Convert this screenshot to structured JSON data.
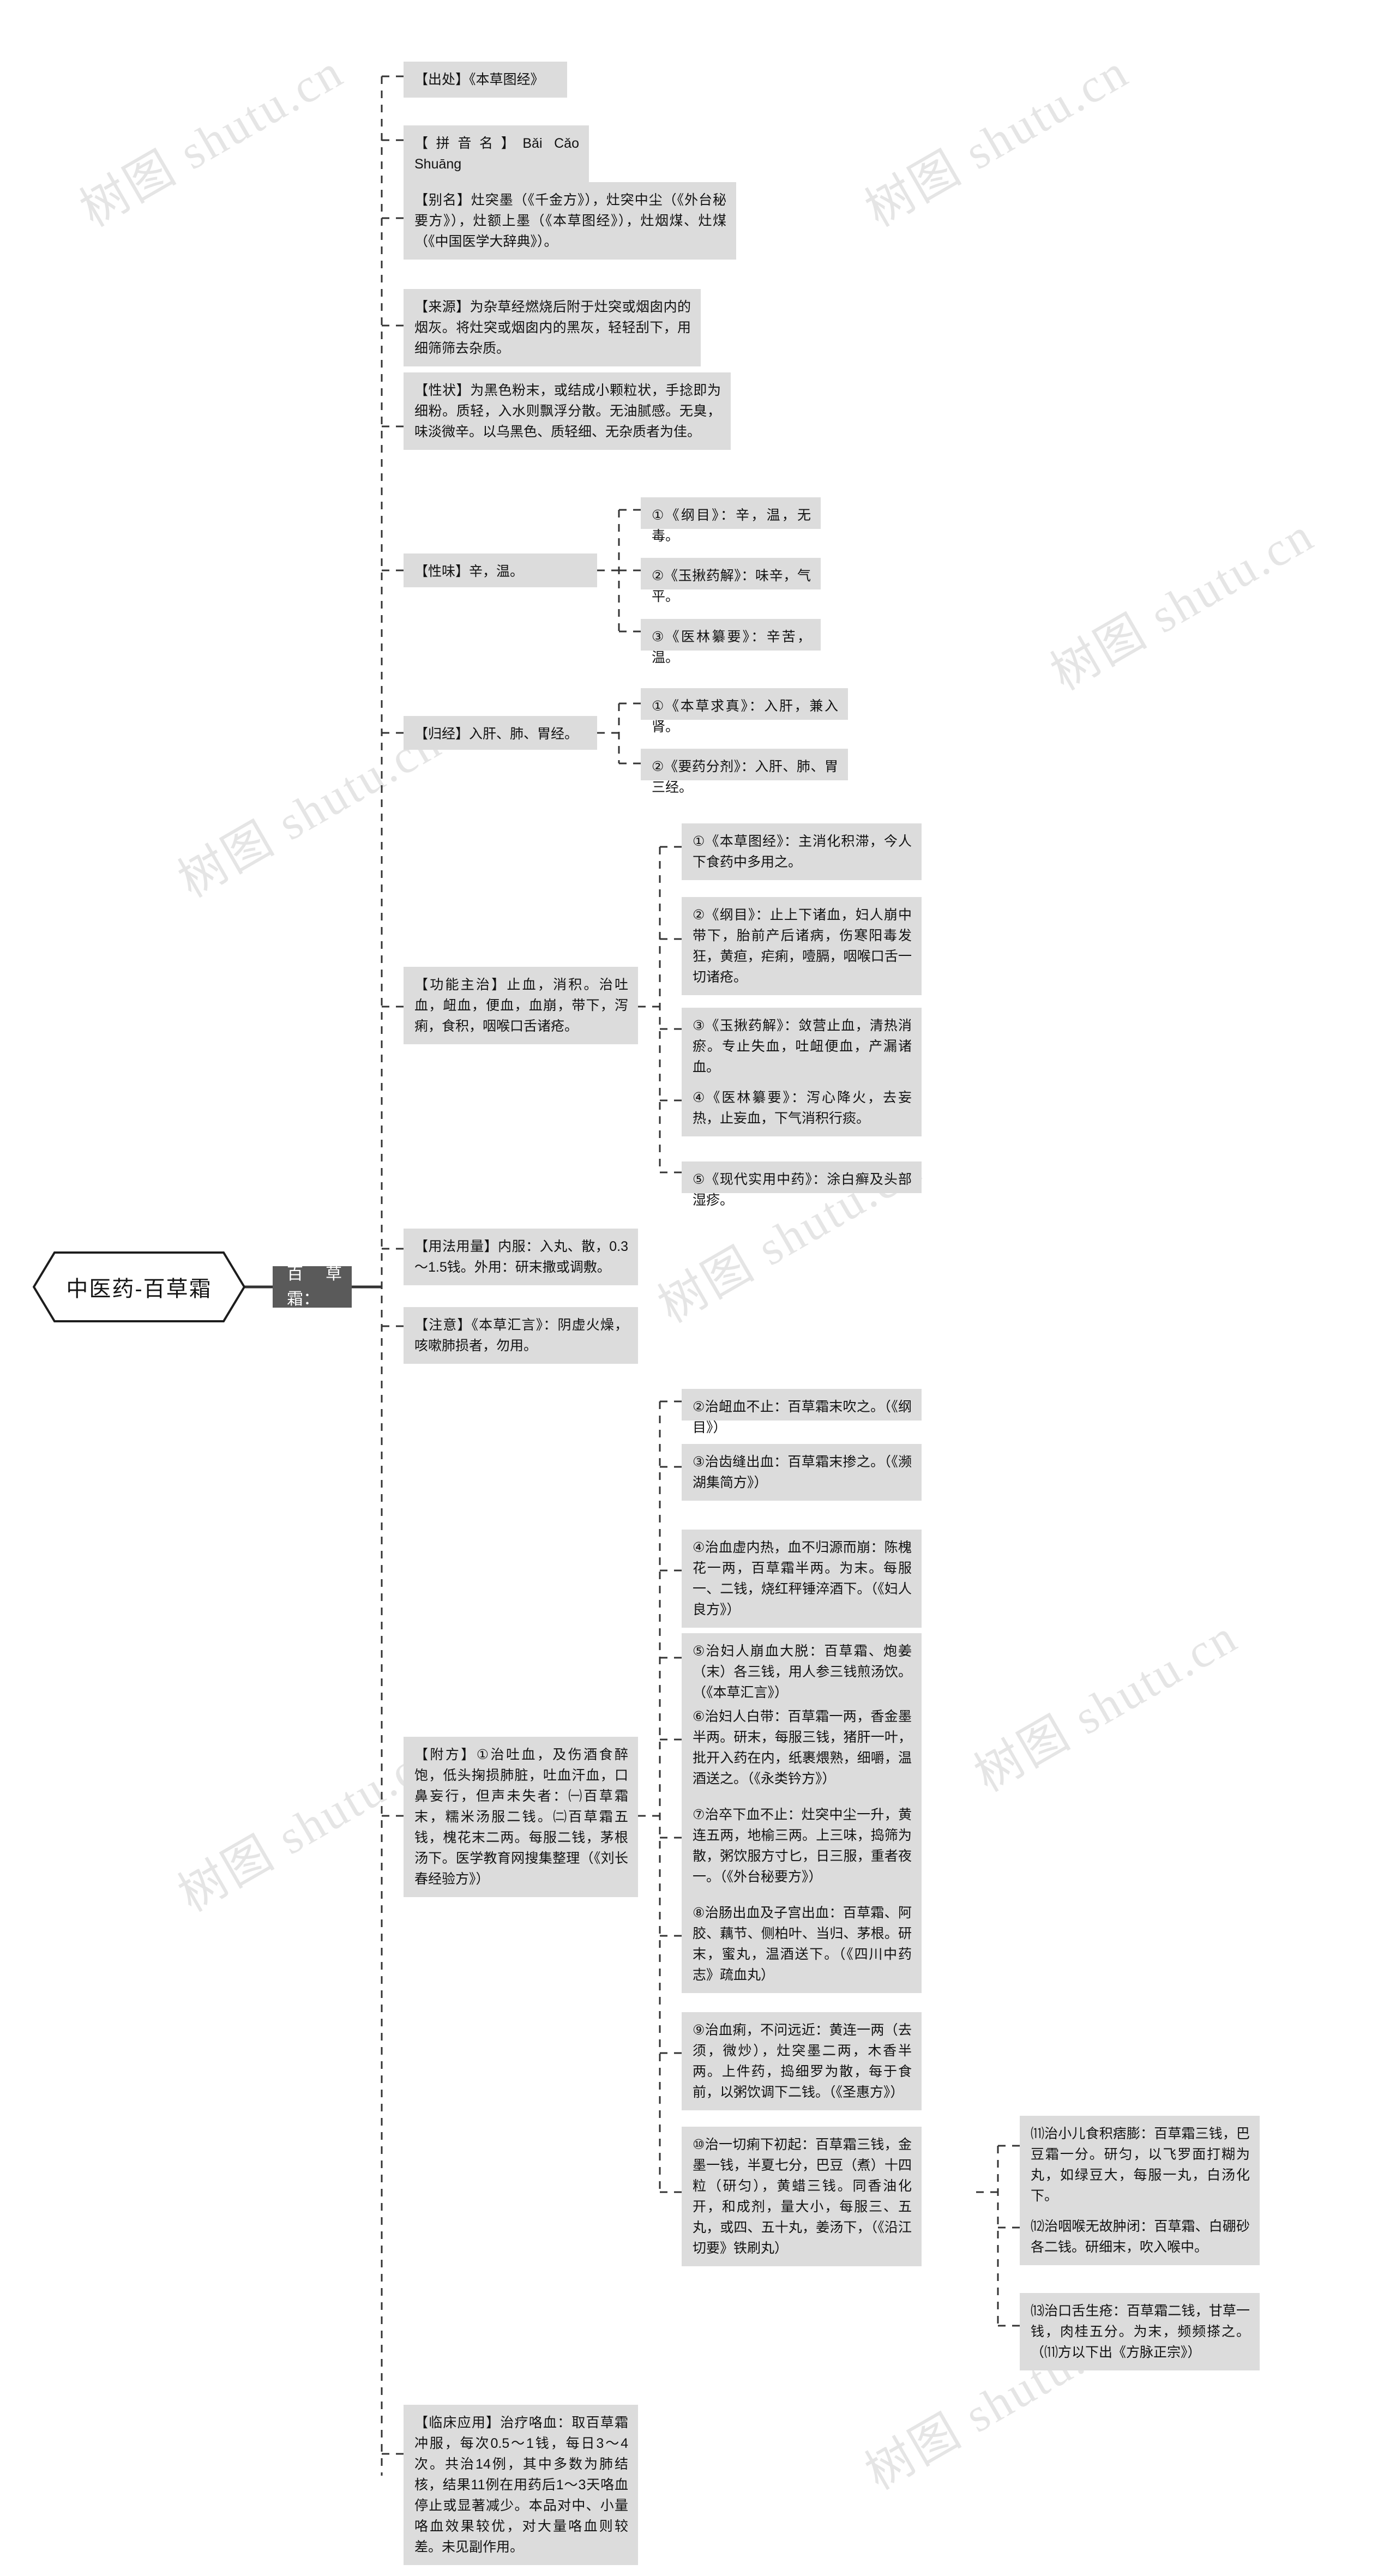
{
  "diagram": {
    "type": "mindmap",
    "root": {
      "label": "中医药-百草霜"
    },
    "level1": {
      "label": "百草霜："
    },
    "watermarks": [
      "树图 shutu.cn",
      "树图 shutu.cn",
      "树图 shutu.cn",
      "树图 shutu.cn",
      "树图 shutu.cn",
      "树图 shutu.cn",
      "树图 shutu.cn",
      "树图 shutu.cn"
    ],
    "nodes": {
      "chuchu": "【出处】《本草图经》",
      "pinyin": "【拼音名】Bǎi Cǎo Shuāng",
      "bieming": "【别名】灶突墨（《千金方》），灶突中尘（《外台秘要方》），灶额上墨（《本草图经》），灶烟煤、灶煤（《中国医学大辞典》）。",
      "laiyuan": "【来源】为杂草经燃烧后附于灶突或烟囱内的烟灰。将灶突或烟囱内的黑灰，轻轻刮下，用细筛筛去杂质。",
      "xingzhuang": "【性状】为黑色粉末，或结成小颗粒状，手捻即为细粉。质轻，入水则飘浮分散。无油腻感。无臭，味淡微辛。以乌黑色、质轻细、无杂质者为佳。",
      "xingwei": "【性味】辛，温。",
      "xingwei_subs": [
        "①《纲目》：辛，温，无毒。",
        "②《玉揪药解》：味辛，气平。",
        "③《医林纂要》：辛苦，温。"
      ],
      "guijing": "【归经】入肝、肺、胃经。",
      "guijing_subs": [
        "①《本草求真》：入肝，兼入肾。",
        "②《要药分剂》：入肝、肺、胃三经。"
      ],
      "gongneng": "【功能主治】止血，消积。治吐血，衄血，便血，血崩，带下，泻痢，食积，咽喉口舌诸疮。",
      "gongneng_subs": [
        "①《本草图经》：主消化积滞，今人下食药中多用之。",
        "②《纲目》：止上下诸血，妇人崩中带下，胎前产后诸病，伤寒阳毒发狂，黄疸，疟痢，噎膈，咽喉口舌一切诸疮。",
        "③《玉揪药解》：敛营止血，清热消瘀。专止失血，吐衄便血，产漏诸血。",
        "④《医林纂要》：泻心降火，去妄热，止妄血，下气消积行痰。",
        "⑤《现代实用中药》：涂白癣及头部湿疹。"
      ],
      "yongfa": "【用法用量】内服：入丸、散，0.3～1.5钱。外用：研末撒或调敷。",
      "zhuyi": "【注意】《本草汇言》：阴虚火燥，咳嗽肺损者，勿用。",
      "fufang": "【附方】①治吐血，及伤酒食醉饱，低头掬损肺脏，吐血汗血，口鼻妄行，但声未失者：㈠百草霜末，糯米汤服二钱。㈡百草霜五钱，槐花末二两。每服二钱，茅根汤下。医学教育网搜集整理（《刘长春经验方》）",
      "fufang_subs": [
        "②治衄血不止：百草霜末吹之。（《纲目》）",
        "③治齿缝出血：百草霜末掺之。（《濒湖集简方》）",
        "④治血虚内热，血不归源而崩：陈槐花一两，百草霜半两。为末。每服一、二钱，烧红秤锤淬酒下。（《妇人良方》）",
        "⑤治妇人崩血大脱：百草霜、炮姜（末）各三钱，用人参三钱煎汤饮。（《本草汇言》）",
        "⑥治妇人白带：百草霜一两，香金墨半两。研末，每服三钱，猪肝一叶，批开入药在内，纸裹煨熟，细嚼，温酒送之。（《永类钤方》）",
        "⑦治卒下血不止：灶突中尘一升，黄连五两，地榆三两。上三味，捣筛为散，粥饮服方寸匕，日三服，重者夜一。（《外台秘要方》）",
        "⑧治肠出血及子宫出血：百草霜、阿胶、藕节、侧柏叶、当归、茅根。研末，蜜丸，温酒送下。（《四川中药志》疏血丸）",
        "⑨治血痢，不问远近：黄连一两（去须，微炒），灶突墨二两，木香半两。上件药，捣细罗为散，每于食前，以粥饮调下二钱。（《圣惠方》）",
        "⑩治一切痢下初起：百草霜三钱，金墨一钱，半夏七分，巴豆（煮）十四粒（研匀），黄蜡三钱。同香油化开，和成剂，量大小，每服三、五丸，或四、五十丸，姜汤下，（《沿江切要》铁刷丸）"
      ],
      "fufang_subs2": [
        "⑾治小儿食积痞膨：百草霜三钱，巴豆霜一分。研匀，以飞罗面打糊为丸，如绿豆大，每服一丸，白汤化下。",
        "⑿治咽喉无故肿闭：百草霜、白硼砂各二钱。研细末，吹入喉中。",
        "⒀治口舌生疮：百草霜二钱，甘草一钱，肉桂五分。为末，频频搽之。（⑾方以下出《方脉正宗》）"
      ],
      "linchuang": "【临床应用】治疗咯血：取百草霜冲服，每次0.5～1钱，每日3～4次。共治14例，其中多数为肺结核，结果11例在用药后1～3天咯血停止或显著减少。本品对中、小量咯血效果较优，对大量咯血则较差。未见副作用。"
    }
  }
}
